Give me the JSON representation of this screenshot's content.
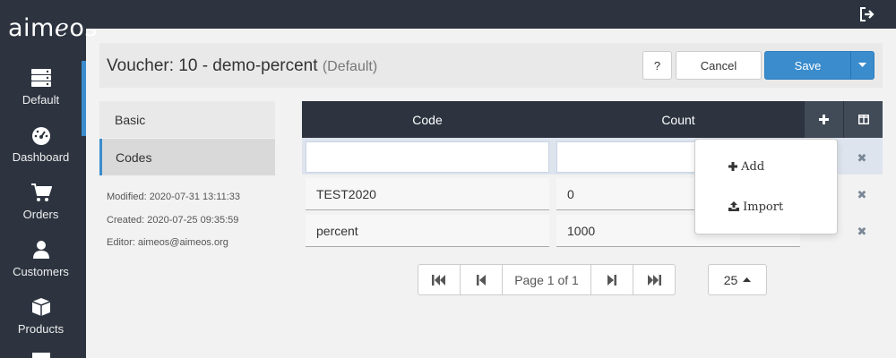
{
  "brand": {
    "logo_pre": "aim",
    "logo_em": "e",
    "logo_post": "os"
  },
  "colors": {
    "sidebar": "#2d3440",
    "accent": "#3a8ccd",
    "header_bg": "#e9e9e9"
  },
  "sidebar": {
    "items": [
      {
        "label": "Default",
        "icon": "server-icon"
      },
      {
        "label": "Dashboard",
        "icon": "dashboard-icon"
      },
      {
        "label": "Orders",
        "icon": "cart-icon"
      },
      {
        "label": "Customers",
        "icon": "user-icon"
      },
      {
        "label": "Products",
        "icon": "box-icon"
      }
    ]
  },
  "header": {
    "title": "Voucher: 10 - demo-percent",
    "subtitle": "(Default)",
    "help_label": "?",
    "cancel_label": "Cancel",
    "save_label": "Save"
  },
  "tabs": {
    "basic": "Basic",
    "codes": "Codes"
  },
  "meta": {
    "modified": "Modified: 2020-07-31 13:11:33",
    "created": "Created: 2020-07-25 09:35:59",
    "editor": "Editor: aimeos@aimeos.org"
  },
  "table": {
    "columns": [
      "Code",
      "Count"
    ],
    "rows": [
      {
        "code": "TEST2020",
        "count": "0"
      },
      {
        "code": "percent",
        "count": "1000"
      }
    ]
  },
  "dropdown": {
    "add_label": "Add",
    "import_label": "Import"
  },
  "pagination": {
    "label": "Page 1 of 1",
    "page_size": "25"
  }
}
